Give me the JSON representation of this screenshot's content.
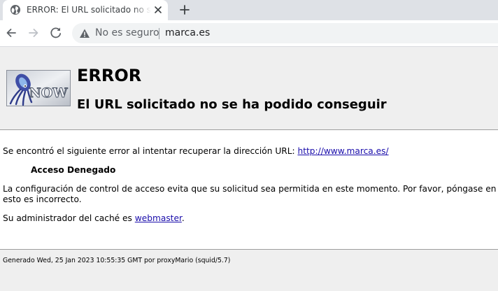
{
  "browser": {
    "tab": {
      "title": "ERROR: El URL solicitado no se ha podido conseguir"
    },
    "omnibox": {
      "security_label": "No es seguro",
      "url": "marca.es"
    }
  },
  "page": {
    "logo_text": "NOW",
    "error_title": "ERROR",
    "error_subtitle": "El URL solicitado no se ha podido conseguir",
    "intro_text": "Se encontró el siguiente error al intentar recuperar la dirección URL: ",
    "requested_url": "http://www.marca.es/",
    "denied_label": "Acceso Denegado",
    "config_line1": "La configuración de control de acceso evita que su solicitud sea permitida en este momento. Por favor, póngase en co",
    "config_line2": "esto es incorrecto.",
    "admin_prefix": "Su administrador del caché es ",
    "admin_link": "webmaster",
    "admin_suffix": ".",
    "footer": "Generado Wed, 25 Jan 2023 10:55:35 GMT por proxyMario (squid/5.7)"
  }
}
